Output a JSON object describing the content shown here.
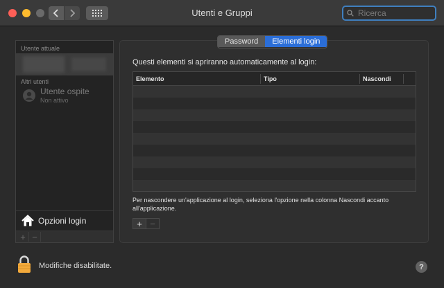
{
  "window": {
    "title": "Utenti e Gruppi",
    "search_placeholder": "Ricerca"
  },
  "sidebar": {
    "current_user_label": "Utente attuale",
    "other_users_label": "Altri utenti",
    "guest_name": "Utente ospite",
    "guest_status": "Non attivo",
    "login_options_label": "Opzioni login",
    "add_symbol": "+",
    "remove_symbol": "−"
  },
  "tabs": [
    {
      "label": "Password",
      "active": false
    },
    {
      "label": "Elementi login",
      "active": true
    }
  ],
  "main": {
    "heading": "Questi elementi si apriranno automaticamente al login:",
    "columns": [
      "Elemento",
      "Tipo",
      "Nascondi"
    ],
    "rows": [],
    "hint": "Per nascondere un'applicazione al login, seleziona l'opzione nella colonna Nascondi accanto all'applicazione.",
    "add_symbol": "+",
    "remove_symbol": "−"
  },
  "footer": {
    "lock_text": "Modifiche disabilitate.",
    "help_symbol": "?"
  },
  "colors": {
    "accent": "#2b6ed8",
    "close": "#fe5f57",
    "minimize": "#febc2e",
    "lock": "#f2a93b"
  },
  "icons": [
    "back-chevron-icon",
    "forward-chevron-icon",
    "grid-icon",
    "search-icon",
    "house-icon",
    "lock-icon",
    "help-icon",
    "user-avatar-icon"
  ]
}
